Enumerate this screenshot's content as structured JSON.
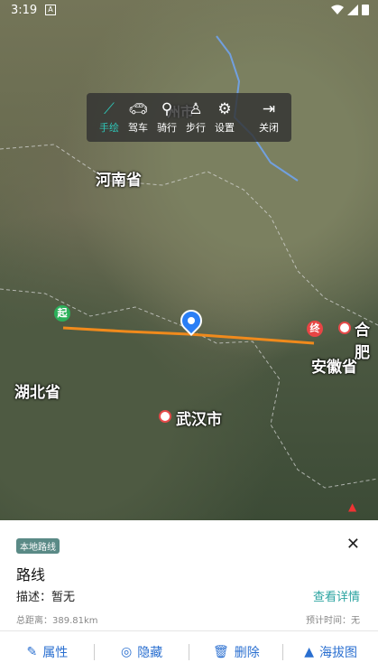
{
  "status": {
    "time": "3:19",
    "notif": "A"
  },
  "toolbar": {
    "items": [
      {
        "label": "手绘",
        "icon": "hand-draw-icon"
      },
      {
        "label": "驾车",
        "icon": "car-icon"
      },
      {
        "label": "骑行",
        "icon": "bicycle-icon"
      },
      {
        "label": "步行",
        "icon": "walk-icon"
      },
      {
        "label": "设置",
        "icon": "gear-icon"
      },
      {
        "label": "关闭",
        "icon": "exit-icon"
      }
    ],
    "partial_label": "州市"
  },
  "map": {
    "labels": {
      "henan": "河南省",
      "hubei": "湖北省",
      "anhui": "安徽省",
      "wuhan": "武汉市",
      "hefei": "合肥"
    },
    "start_marker": "起",
    "end_marker": "终"
  },
  "panel": {
    "tag": "本地路线",
    "close": "✕",
    "title": "路线",
    "description": "描述：暂无",
    "detail_link": "查看详情",
    "distance": "总距离：389.81km",
    "estimated_time": "预计时间：无"
  },
  "actions": [
    {
      "label": "属性",
      "icon": "edit-icon"
    },
    {
      "label": "隐藏",
      "icon": "eye-hidden-icon"
    },
    {
      "label": "删除",
      "icon": "trash-icon"
    },
    {
      "label": "海拔图",
      "icon": "mountain-icon"
    }
  ],
  "colors": {
    "route": "#f08a1c",
    "accent": "#2aa3a0",
    "action": "#2a6fd0"
  }
}
